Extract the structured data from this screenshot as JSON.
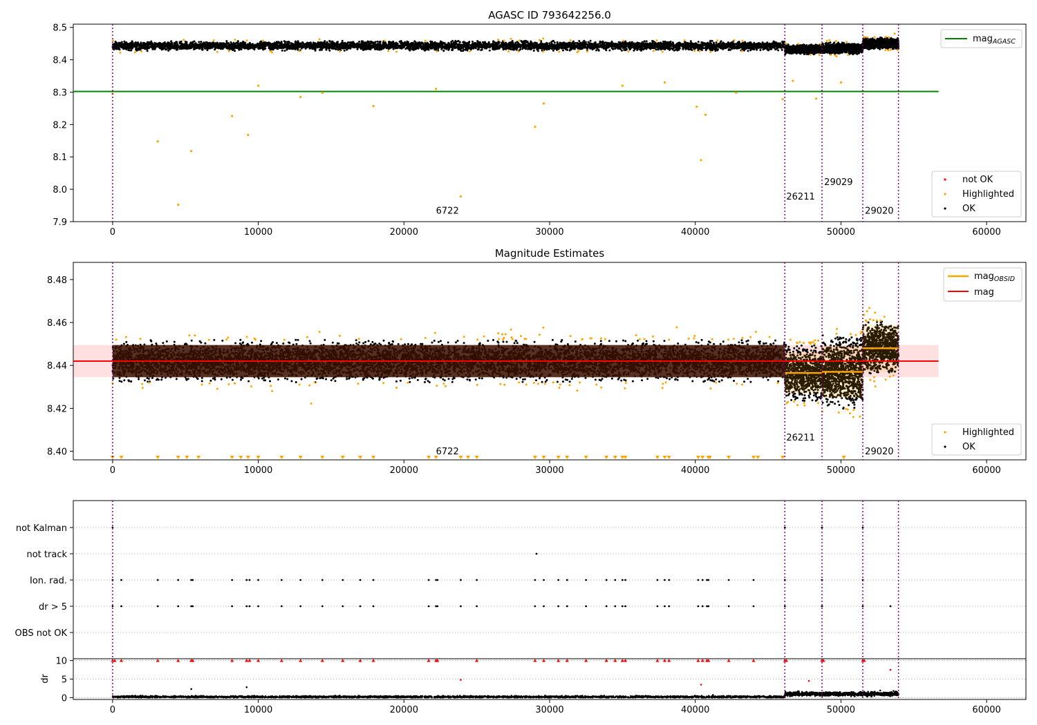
{
  "chart_data": [
    {
      "type": "scatter",
      "title": "AGASC ID 793642256.0",
      "xlabel": "",
      "ylabel": "",
      "xlim": [
        -2700,
        62700
      ],
      "ylim": [
        7.9,
        8.51
      ],
      "xticks": [
        0,
        10000,
        20000,
        30000,
        40000,
        50000,
        60000
      ],
      "xtick_labels": [
        "0",
        "10000",
        "20000",
        "30000",
        "40000",
        "50000",
        "60000"
      ],
      "yticks": [
        7.9,
        8.0,
        8.1,
        8.2,
        8.3,
        8.4,
        8.5
      ],
      "ytick_labels": [
        "7.9",
        "8.0",
        "8.1",
        "8.2",
        "8.3",
        "8.4",
        "8.5"
      ],
      "vlines": [
        0,
        46150,
        48700,
        51500,
        53950
      ],
      "obsid_labels": [
        {
          "text": "6722",
          "x": 22200,
          "y": 7.925
        },
        {
          "text": "26211",
          "x": 46250,
          "y": 7.968
        },
        {
          "text": "29029",
          "x": 48850,
          "y": 8.013
        },
        {
          "text": "29020",
          "x": 51650,
          "y": 7.925
        }
      ],
      "mag_agasc": {
        "value": 8.302,
        "x": [
          -2700,
          56700
        ]
      },
      "segments": [
        {
          "x": [
            0,
            46150
          ],
          "center": 8.443,
          "spread": 0.011
        },
        {
          "x": [
            46150,
            48700
          ],
          "center": 8.432,
          "spread": 0.011
        },
        {
          "x": [
            48700,
            51500
          ],
          "center": 8.435,
          "spread": 0.013
        },
        {
          "x": [
            51500,
            53950
          ],
          "center": 8.45,
          "spread": 0.013
        }
      ],
      "highlighted_outliers": [
        [
          0,
          8.295
        ],
        [
          3100,
          8.148
        ],
        [
          4500,
          7.952
        ],
        [
          5400,
          8.118
        ],
        [
          8200,
          8.226
        ],
        [
          9300,
          8.168
        ],
        [
          10000,
          8.32
        ],
        [
          12900,
          8.285
        ],
        [
          14400,
          8.298
        ],
        [
          17900,
          8.257
        ],
        [
          22200,
          8.31
        ],
        [
          23900,
          7.978
        ],
        [
          29000,
          8.193
        ],
        [
          29600,
          8.265
        ],
        [
          35000,
          8.32
        ],
        [
          37900,
          8.33
        ],
        [
          40100,
          8.255
        ],
        [
          40400,
          8.09
        ],
        [
          40700,
          8.23
        ],
        [
          42800,
          8.298
        ],
        [
          46000,
          8.278
        ],
        [
          46700,
          8.335
        ],
        [
          48300,
          8.28
        ],
        [
          50000,
          8.33
        ]
      ],
      "legends": [
        {
          "position": "upper right",
          "entries": [
            {
              "label": "mag",
              "subscript": "AGASC",
              "color": "#008000",
              "marker": "line"
            }
          ]
        },
        {
          "position": "lower right",
          "entries": [
            {
              "label": "not OK",
              "color": "#ff0000",
              "marker": "dot"
            },
            {
              "label": "Highlighted",
              "color": "#ffa500",
              "marker": "dot"
            },
            {
              "label": "OK",
              "color": "#000000",
              "marker": "dot"
            }
          ]
        }
      ]
    },
    {
      "type": "scatter",
      "title": "Magnitude Estimates",
      "xlabel": "",
      "ylabel": "",
      "xlim": [
        -2700,
        62700
      ],
      "ylim": [
        8.396,
        8.488
      ],
      "xticks": [
        0,
        10000,
        20000,
        30000,
        40000,
        50000,
        60000
      ],
      "xtick_labels": [
        "0",
        "10000",
        "20000",
        "30000",
        "40000",
        "50000",
        "60000"
      ],
      "yticks": [
        8.4,
        8.42,
        8.44,
        8.46,
        8.48
      ],
      "ytick_labels": [
        "8.40",
        "8.42",
        "8.44",
        "8.46",
        "8.48"
      ],
      "vlines": [
        0,
        46150,
        48700,
        51500,
        53950
      ],
      "obsid_labels": [
        {
          "text": "6722",
          "x": 22200,
          "y": 8.3985
        },
        {
          "text": "26211",
          "x": 46250,
          "y": 8.405
        },
        {
          "text": "29020",
          "x": 51650,
          "y": 8.3985
        }
      ],
      "mag": {
        "value": 8.442,
        "band": [
          8.4345,
          8.4495
        ],
        "x": [
          -2700,
          56700
        ]
      },
      "mag_obsid": [
        {
          "x": [
            46150,
            48700
          ],
          "value": 8.4365,
          "band": [
            8.427,
            8.446
          ]
        },
        {
          "x": [
            48700,
            51500
          ],
          "value": 8.437,
          "band": [
            8.425,
            8.449
          ]
        },
        {
          "x": [
            51500,
            53950
          ],
          "value": 8.448,
          "band": [
            8.437,
            8.459
          ]
        }
      ],
      "segments": [
        {
          "x": [
            0,
            46150
          ],
          "center": 8.442,
          "spread": 0.0075
        },
        {
          "x": [
            46150,
            48700
          ],
          "center": 8.4365,
          "spread": 0.01
        },
        {
          "x": [
            48700,
            51500
          ],
          "center": 8.437,
          "spread": 0.013
        },
        {
          "x": [
            51500,
            53950
          ],
          "center": 8.448,
          "spread": 0.0095
        }
      ],
      "clipped_markers_x": [
        0,
        600,
        3100,
        4500,
        5100,
        5900,
        8200,
        8800,
        9300,
        10000,
        11600,
        12900,
        14400,
        15800,
        17000,
        17900,
        21700,
        22200,
        23900,
        24400,
        25000,
        29000,
        29600,
        30600,
        31200,
        32500,
        33900,
        34500,
        35000,
        35200,
        37400,
        37900,
        38200,
        40200,
        40500,
        40900,
        41000,
        42300,
        44000,
        44300,
        46000,
        50200
      ],
      "legends": [
        {
          "position": "upper right",
          "entries": [
            {
              "label": "mag",
              "subscript": "OBSID",
              "color": "#ffa500",
              "marker": "line"
            },
            {
              "label": "mag",
              "color": "#ff0000",
              "marker": "line"
            }
          ]
        },
        {
          "position": "lower right",
          "entries": [
            {
              "label": "Highlighted",
              "color": "#ffa500",
              "marker": "dot"
            },
            {
              "label": "OK",
              "color": "#000000",
              "marker": "dot"
            }
          ]
        }
      ]
    },
    {
      "type": "scatter",
      "title": "",
      "xlabel": "",
      "ylabel": "",
      "xlim": [
        -2700,
        62700
      ],
      "vlines": [
        0,
        46150,
        48700,
        51500,
        53950
      ],
      "categories": [
        "not Kalman",
        "not track",
        "Ion. rad.",
        "dr > 5",
        "OBS not OK"
      ],
      "flags": [
        {
          "category": "not Kalman",
          "x": [
            0,
            46150,
            48700,
            51500
          ]
        },
        {
          "category": "not track",
          "x": [
            29100
          ]
        },
        {
          "category": "Ion. rad.",
          "x": [
            0,
            600,
            3100,
            4500,
            5400,
            5500,
            8200,
            9200,
            9400,
            10000,
            11600,
            12900,
            14400,
            15800,
            17000,
            17900,
            21700,
            22200,
            22300,
            23900,
            25000,
            29000,
            29600,
            30600,
            31200,
            32500,
            33900,
            34500,
            35000,
            35200,
            37400,
            37900,
            38200,
            40200,
            40500,
            40800,
            40900,
            42300,
            44000,
            46150,
            48700,
            51500
          ]
        },
        {
          "category": "dr > 5",
          "x": [
            0,
            600,
            3100,
            4500,
            5400,
            5500,
            8200,
            9200,
            9400,
            10000,
            11600,
            12900,
            14400,
            15800,
            17000,
            17900,
            21700,
            22200,
            22300,
            23900,
            25000,
            29000,
            29600,
            30600,
            31200,
            32500,
            33900,
            34500,
            35000,
            35200,
            37400,
            37900,
            38200,
            40200,
            40500,
            40800,
            40900,
            42300,
            44000,
            46150,
            48700,
            51500,
            53400
          ]
        },
        {
          "category": "OBS not OK",
          "x": []
        }
      ]
    },
    {
      "type": "scatter",
      "title": "",
      "xlabel": "",
      "ylabel": "dr",
      "xlim": [
        -2700,
        62700
      ],
      "ylim": [
        -0.5,
        10.5
      ],
      "xticks": [
        0,
        10000,
        20000,
        30000,
        40000,
        50000,
        60000
      ],
      "xtick_labels": [
        "0",
        "10000",
        "20000",
        "30000",
        "40000",
        "50000",
        "60000"
      ],
      "yticks": [
        0,
        5,
        10
      ],
      "ytick_labels": [
        "0",
        "5",
        "10"
      ],
      "vlines": [
        0,
        46150,
        48700,
        51500,
        53950
      ],
      "segments": [
        {
          "x": [
            0,
            46150
          ],
          "center": 0.2,
          "spread": 0.2
        },
        {
          "x": [
            46150,
            53950
          ],
          "center": 1.0,
          "spread": 0.4
        }
      ],
      "ok_outliers": [
        [
          5400,
          2.3
        ],
        [
          9200,
          2.8
        ]
      ],
      "red_clipped_x": [
        0,
        150,
        600,
        3100,
        4500,
        5400,
        5500,
        8200,
        9200,
        9400,
        10000,
        11600,
        12900,
        14400,
        15800,
        17000,
        17900,
        21700,
        22200,
        22300,
        25000,
        29000,
        29600,
        30600,
        31200,
        32500,
        33900,
        34500,
        35000,
        35200,
        37400,
        37900,
        38200,
        40200,
        40500,
        40800,
        40900,
        42300,
        44000,
        46150,
        46250,
        48700,
        48800,
        51500,
        51600
      ],
      "red_points": [
        [
          23900,
          4.8
        ],
        [
          40400,
          3.5
        ],
        [
          47800,
          4.5
        ],
        [
          53400,
          7.5
        ]
      ]
    }
  ]
}
